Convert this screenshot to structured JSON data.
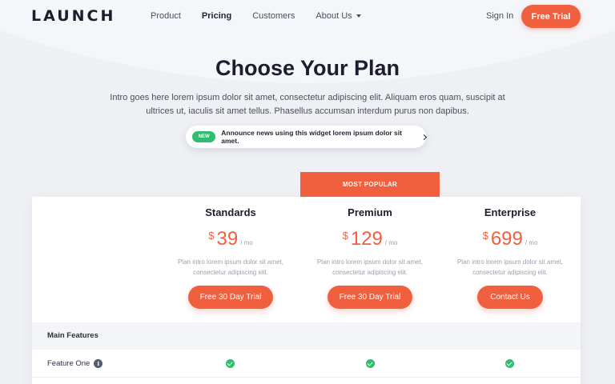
{
  "brand": {
    "logo": "LAUNCH"
  },
  "nav": {
    "items": [
      {
        "label": "Product"
      },
      {
        "label": "Pricing"
      },
      {
        "label": "Customers"
      },
      {
        "label": "About Us"
      }
    ],
    "sign_in": "Sign In",
    "cta": "Free Trial"
  },
  "hero": {
    "title": "Choose Your Plan",
    "intro": "Intro goes here lorem ipsum dolor sit amet, consectetur adipiscing elit. Aliquam eros quam, suscipit at ultrices ut, iaculis sit amet tellus. Phasellus accumsan interdum purus non dapibus."
  },
  "announcement": {
    "badge": "NEW",
    "text": "Announce news using this widget lorem ipsum dolor sit amet.",
    "icon": "chevron-right-icon"
  },
  "pricing": {
    "most_popular": "MOST POPULAR",
    "plans": [
      {
        "name": "Standards",
        "currency": "$",
        "amount": "39",
        "period": "/ mo",
        "description": "Plan intro lorem ipsum dolor sit amet, consectetur adipiscing elit.",
        "button": "Free 30 Day Trial"
      },
      {
        "name": "Premium",
        "currency": "$",
        "amount": "129",
        "period": "/ mo",
        "description": "Plan intro lorem ipsum dolor sit amet, consectetur adipiscing elit.",
        "button": "Free 30 Day Trial"
      },
      {
        "name": "Enterprise",
        "currency": "$",
        "amount": "699",
        "period": "/ mo",
        "description": "Plan intro lorem ipsum dolor sit amet, consectetur adipiscing elit.",
        "button": "Contact Us"
      }
    ]
  },
  "features": {
    "section_title": "Main Features",
    "rows": [
      {
        "label": "Feature One",
        "included": [
          true,
          true,
          true
        ]
      }
    ]
  },
  "colors": {
    "accent": "#f05f3e",
    "success": "#2fbd6e",
    "background": "#f1f2f6"
  }
}
